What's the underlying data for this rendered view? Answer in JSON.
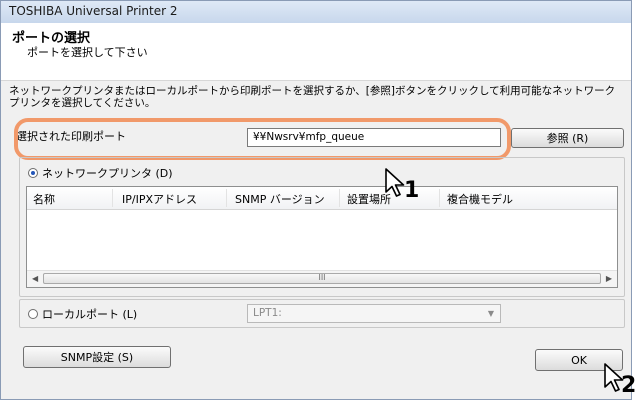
{
  "window": {
    "title": "TOSHIBA Universal Printer 2"
  },
  "header": {
    "title": "ポートの選択",
    "subtitle": "ポートを選択して下さい"
  },
  "description": "ネットワークプリンタまたはローカルポートから印刷ポートを選択するか、[参照]ボタンをクリックして利用可能なネットワークプリンタを選択してください。",
  "selected_port": {
    "label": "選択された印刷ポート",
    "value": "¥¥Nwsrv¥mfp_queue",
    "browse_label": "参照 (R)"
  },
  "network": {
    "radio_label": "ネットワークプリンタ (D)",
    "checked": true,
    "columns": [
      "名称",
      "IP/IPXアドレス",
      "SNMP バージョン",
      "設置場所",
      "複合機モデル"
    ],
    "rows": [],
    "scroll_grip": "III"
  },
  "local": {
    "radio_label": "ローカルポート (L)",
    "checked": false,
    "selected_value": "LPT1:"
  },
  "footer": {
    "snmp_label": "SNMP設定 (S)",
    "ok_label": "OK"
  },
  "annotations": {
    "step1": "1",
    "step2": "2"
  },
  "colors": {
    "highlight": "#f1996a",
    "radio_dot": "#2456b8"
  }
}
